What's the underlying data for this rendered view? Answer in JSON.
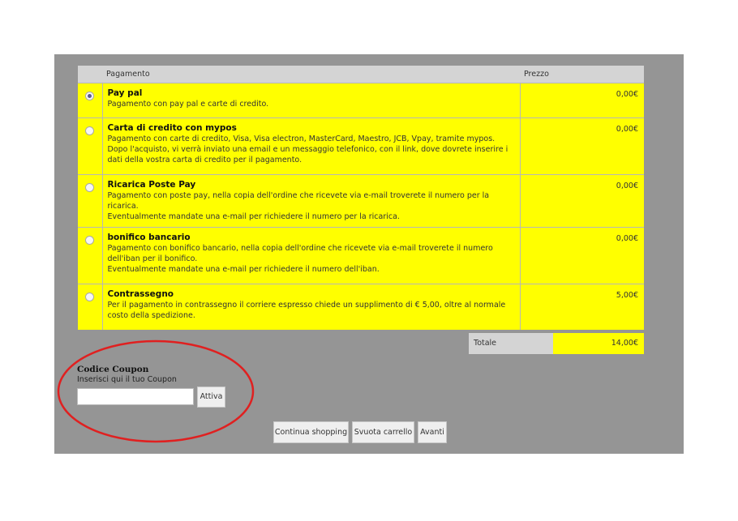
{
  "table": {
    "header_payment": "Pagamento",
    "header_price": "Prezzo",
    "methods": [
      {
        "name": "Pay pal",
        "description": "Pagamento con pay pal e carte di credito.",
        "price": "0,00€",
        "selected": true
      },
      {
        "name": "Carta di credito con mypos",
        "description": "Pagamento con carte di credito, Visa, Visa electron, MasterCard, Maestro, JCB, Vpay, tramite mypos.\nDopo l'acquisto, vi verrà inviato una email e un messaggio telefonico, con il link, dove dovrete inserire i dati della vostra carta di credito per il pagamento.",
        "price": "0,00€",
        "selected": false
      },
      {
        "name": "Ricarica Poste Pay",
        "description": "Pagamento con poste pay, nella copia dell'ordine che ricevete via e-mail troverete il numero per la ricarica.\nEventualmente mandate una e-mail per richiedere il numero per la ricarica.",
        "price": "0,00€",
        "selected": false
      },
      {
        "name": "bonifico bancario",
        "description": "Pagamento con bonifico bancario, nella copia dell'ordine che ricevete via e-mail troverete il numero dell'iban per il bonifico.\nEventualmente mandate una e-mail per richiedere il numero dell'iban.",
        "price": "0,00€",
        "selected": false
      },
      {
        "name": "Contrassegno",
        "description": "Per il pagamento in contrassegno il corriere espresso chiede un supplimento di € 5,00, oltre al normale costo della spedizione.",
        "price": "5,00€",
        "selected": false
      }
    ]
  },
  "total": {
    "label": "Totale",
    "value": "14,00€"
  },
  "coupon": {
    "title": "Codice Coupon",
    "hint": "Inserisci qui il tuo Coupon",
    "input_value": "",
    "button_label": "Attiva"
  },
  "actions": {
    "continue_label": "Continua shopping",
    "empty_label": "Svuota carrello",
    "next_label": "Avanti"
  },
  "colors": {
    "panel_bg": "#959595",
    "row_bg": "#ffff00",
    "header_bg": "#d4d4d4",
    "annotation": "#e02020"
  }
}
